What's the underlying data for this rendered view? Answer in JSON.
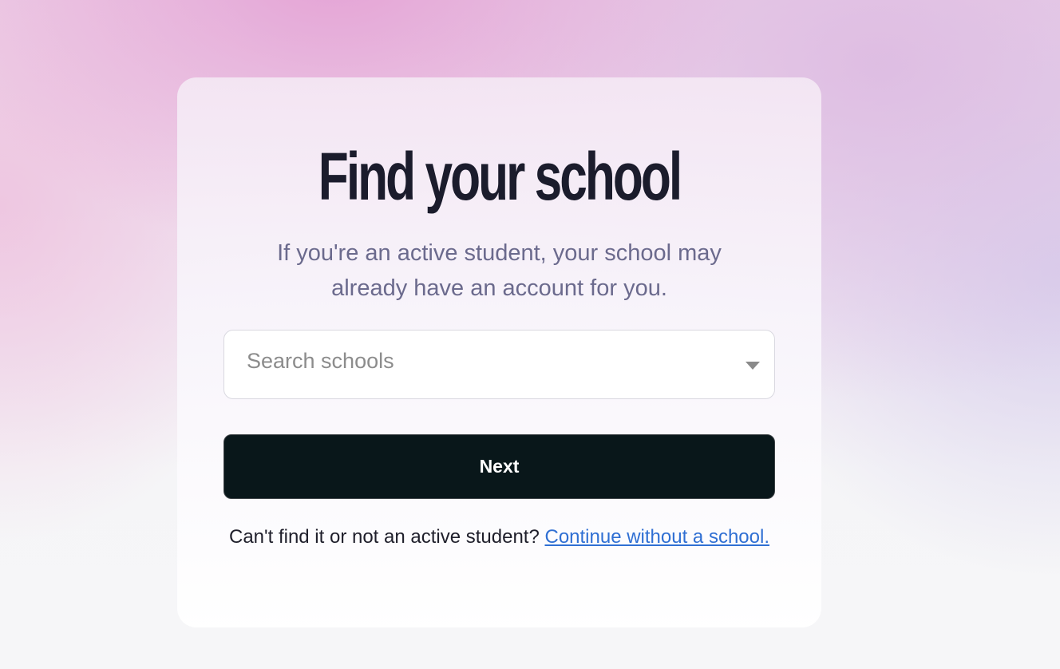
{
  "page": {
    "title": "Find your school",
    "subtitle": "If you're an active student, your school may already have an account for you."
  },
  "search": {
    "placeholder": "Search schools",
    "value": "",
    "icon": "chevron-down-icon"
  },
  "actions": {
    "next_label": "Next"
  },
  "footer": {
    "prompt": "Can't find it or not an active student? ",
    "link_label": "Continue without a school."
  },
  "colors": {
    "button_bg": "#09171a",
    "link": "#2f6fd3",
    "title": "#1b1c2c",
    "subtitle": "#6b6a8d"
  }
}
